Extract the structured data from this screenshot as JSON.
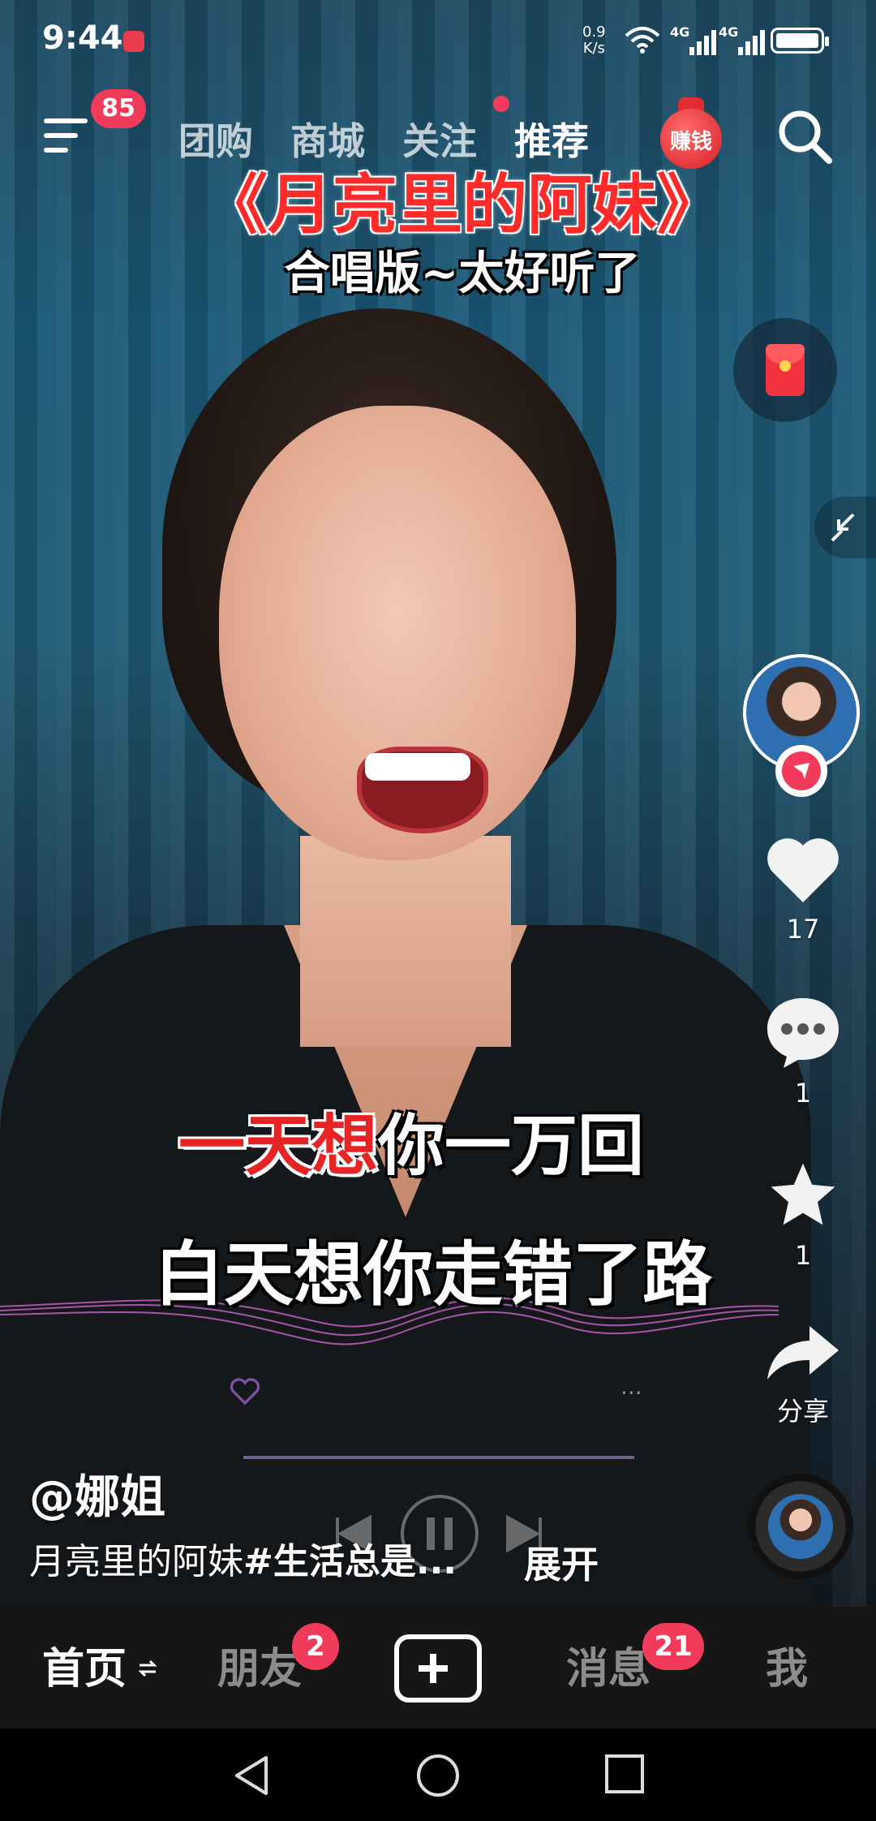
{
  "status_bar": {
    "time": "9:44",
    "net_speed_value": "0.9",
    "net_speed_unit": "K/s",
    "network1": "4G",
    "network2": "4G"
  },
  "top_nav": {
    "menu_badge": "85",
    "tabs": [
      "团购",
      "商城",
      "关注",
      "推荐"
    ],
    "active_tab": "推荐",
    "earn_label": "赚钱"
  },
  "video": {
    "title": "《月亮里的阿妹》",
    "subtitle": "合唱版~太好听了",
    "lyric_line1_highlight": "一天想",
    "lyric_line1_rest": "你一万回",
    "lyric_line2": "白天想你走错了路",
    "player_more": "···"
  },
  "actions": {
    "like_count": "17",
    "comment_count": "1",
    "favorite_count": "1",
    "share_label": "分享"
  },
  "caption": {
    "author": "@娜姐",
    "text": "月亮里的阿妹",
    "hashtag": "#生活总是...",
    "expand": "展开"
  },
  "bottom_tabs": {
    "home": "首页",
    "friends": "朋友",
    "friends_badge": "2",
    "messages": "消息",
    "messages_badge": "21",
    "me": "我"
  },
  "colors": {
    "accent": "#f23a5a",
    "title_red": "#ff2a2a",
    "tabbar_bg": "#161616"
  }
}
